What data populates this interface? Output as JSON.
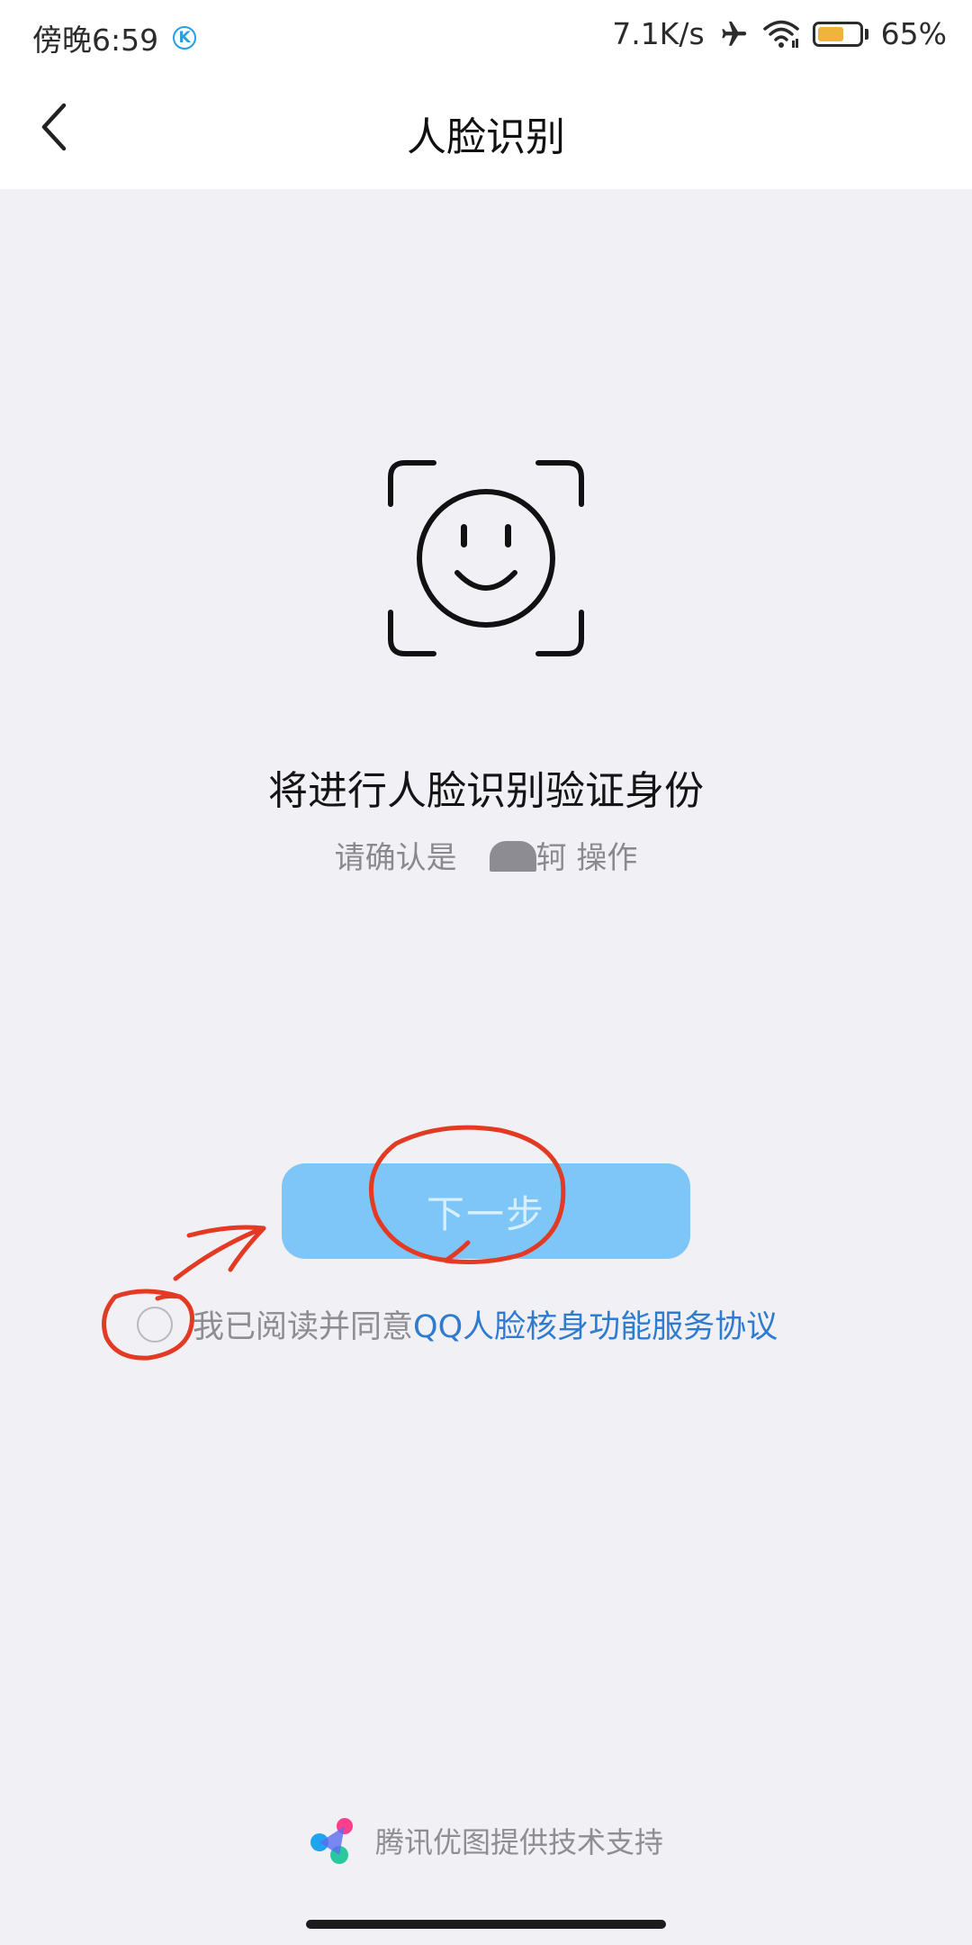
{
  "status_bar": {
    "time": "傍晚6:59",
    "badge_letter": "K",
    "network_speed": "7.1K/s",
    "battery_percent": "65%",
    "battery_level": 0.65,
    "battery_fill_color": "#f0b43d",
    "icons": [
      "airplane-icon",
      "wifi-icon",
      "battery-icon"
    ]
  },
  "nav": {
    "back_icon": "chevron-left-icon",
    "title": "人脸识别"
  },
  "main": {
    "face_icon": "smiley-face-scan-icon",
    "headline": "将进行人脸识别验证身份",
    "confirm_prefix": "请确认是",
    "confirm_name_visible": "轲",
    "confirm_suffix": "操作",
    "next_button_label": "下一步",
    "next_button_color": "#7fc6f8"
  },
  "agreement": {
    "checked": false,
    "text": "我已阅读并同意",
    "link_text": "QQ人脸核身功能服务协议",
    "link_color": "#2f7bd0"
  },
  "annotations": {
    "color": "#e33a24",
    "marks": [
      "circle-around-next-button",
      "circle-around-checkbox",
      "arrow-to-next-button"
    ]
  },
  "footer": {
    "logo_icon": "tencent-youtu-logo-icon",
    "text": "腾讯优图提供技术支持"
  }
}
